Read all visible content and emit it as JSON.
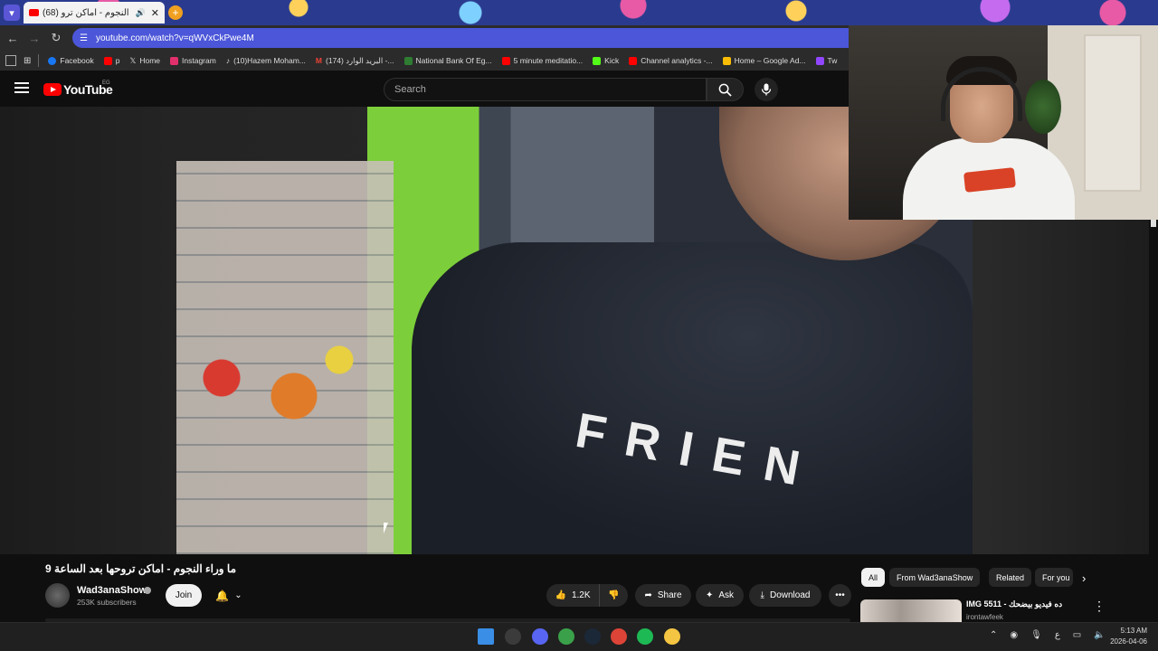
{
  "browser": {
    "tab_title": "(68) ما وراء النجوم - اماكن ترو",
    "url": "youtube.com/watch?v=qWVxCkPwe4M",
    "bookmarks": [
      {
        "label": "Facebook",
        "color": "#1877f2"
      },
      {
        "label": "p",
        "color": "#ff0000"
      },
      {
        "label": "Home",
        "color": "#ffffff"
      },
      {
        "label": "Instagram",
        "color": "#e1306c"
      },
      {
        "label": "(10)Hazem Moham...",
        "color": "#ffffff"
      },
      {
        "label": "(174) البريد الوارد -...",
        "color": "#ea4335"
      },
      {
        "label": "National Bank Of Eg...",
        "color": "#2e7d32"
      },
      {
        "label": "5 minute meditatio...",
        "color": "#ff0000"
      },
      {
        "label": "Kick",
        "color": "#53fc18"
      },
      {
        "label": "Channel analytics -...",
        "color": "#ff0000"
      },
      {
        "label": "Home – Google Ad...",
        "color": "#fbbc04"
      },
      {
        "label": "Tw",
        "color": "#9146ff"
      }
    ]
  },
  "youtube": {
    "logo_text": "YouTube",
    "region": "EG",
    "search_placeholder": "Search"
  },
  "video": {
    "title": "ما وراء النجوم - اماكن تروحها بعد الساعة 9",
    "shirt_print": "FRIEN",
    "channel_name": "Wad3anaShow",
    "subscribers": "253K subscribers",
    "join_label": "Join",
    "likes": "1.2K",
    "share_label": "Share",
    "ask_label": "Ask",
    "download_label": "Download"
  },
  "chips": [
    "All",
    "From Wad3anaShow",
    "Related",
    "For you"
  ],
  "recommendation": {
    "title": "IMG 5511 - ده فيديو بيضحك",
    "channel": "irontawfeek"
  },
  "taskbar": {
    "time": "5:13 AM",
    "date": "2026-04-06",
    "lang": "ع",
    "apps": [
      {
        "name": "windows-start-icon",
        "color": "#3a8ee6"
      },
      {
        "name": "obs-icon",
        "color": "#3b3b3b"
      },
      {
        "name": "discord-icon",
        "color": "#5865f2"
      },
      {
        "name": "xbox-icon",
        "color": "#3aa14a"
      },
      {
        "name": "steam-icon",
        "color": "#1b2838"
      },
      {
        "name": "chrome-icon",
        "color": "#db4437"
      },
      {
        "name": "spotify-icon",
        "color": "#1db954"
      },
      {
        "name": "file-explorer-icon",
        "color": "#f4c542"
      }
    ]
  }
}
